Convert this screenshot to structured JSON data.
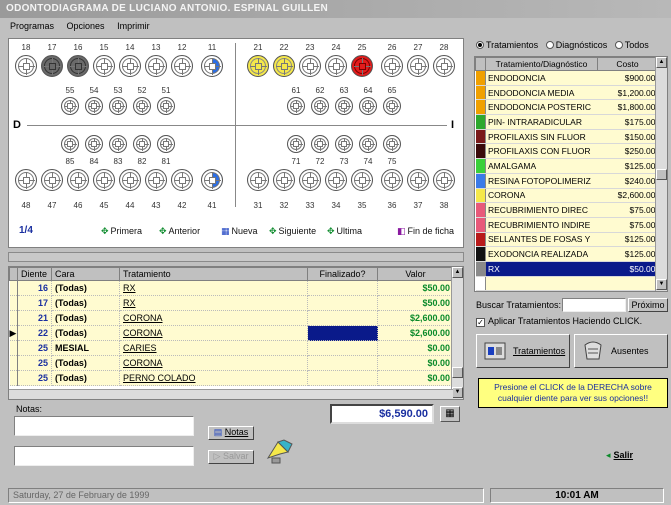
{
  "window": {
    "title": "ODONTODIAGRAMA DE LUCIANO ANTONIO. ESPINAL GUILLEN"
  },
  "menu": [
    "Programas",
    "Opciones",
    "Imprimir"
  ],
  "odontogram": {
    "side_left": "D",
    "side_right": "I",
    "upper_adult": [
      {
        "num": "18",
        "state": "normal"
      },
      {
        "num": "17",
        "state": "gray"
      },
      {
        "num": "16",
        "state": "gray"
      },
      {
        "num": "15",
        "state": "normal"
      },
      {
        "num": "14",
        "state": "normal"
      },
      {
        "num": "13",
        "state": "normal"
      },
      {
        "num": "12",
        "state": "normal"
      },
      {
        "num": "11",
        "state": "bluehalf"
      },
      {
        "num": "21",
        "state": "yellow"
      },
      {
        "num": "22",
        "state": "yellow"
      },
      {
        "num": "23",
        "state": "normal"
      },
      {
        "num": "24",
        "state": "normal"
      },
      {
        "num": "25",
        "state": "red"
      },
      {
        "num": "26",
        "state": "normal"
      },
      {
        "num": "27",
        "state": "normal"
      },
      {
        "num": "28",
        "state": "normal"
      }
    ],
    "upper_child": [
      "55",
      "54",
      "53",
      "52",
      "51",
      "61",
      "62",
      "63",
      "64",
      "65"
    ],
    "lower_child": [
      "85",
      "84",
      "83",
      "82",
      "81",
      "71",
      "72",
      "73",
      "74",
      "75"
    ],
    "lower_adult": [
      {
        "num": "48",
        "state": "normal"
      },
      {
        "num": "47",
        "state": "normal"
      },
      {
        "num": "46",
        "state": "normal"
      },
      {
        "num": "45",
        "state": "normal"
      },
      {
        "num": "44",
        "state": "normal"
      },
      {
        "num": "43",
        "state": "normal"
      },
      {
        "num": "42",
        "state": "normal"
      },
      {
        "num": "41",
        "state": "bluehalf"
      },
      {
        "num": "31",
        "state": "normal"
      },
      {
        "num": "32",
        "state": "normal"
      },
      {
        "num": "33",
        "state": "normal"
      },
      {
        "num": "34",
        "state": "normal"
      },
      {
        "num": "35",
        "state": "normal"
      },
      {
        "num": "36",
        "state": "normal"
      },
      {
        "num": "37",
        "state": "normal"
      },
      {
        "num": "38",
        "state": "normal"
      }
    ]
  },
  "nav": {
    "pager": "1/4",
    "first": "Primera",
    "prev": "Anterior",
    "new": "Nueva",
    "next": "Siguiente",
    "last": "Ultima",
    "end": "Fin de ficha"
  },
  "grid": {
    "headers": [
      "Diente",
      "Cara",
      "Tratamiento",
      "Finalizado?",
      "Valor"
    ],
    "rows": [
      {
        "diente": "16",
        "cara": "(Todas)",
        "trat": "RX",
        "fin": false,
        "valor": "$50.00"
      },
      {
        "diente": "17",
        "cara": "(Todas)",
        "trat": "RX",
        "fin": false,
        "valor": "$50.00"
      },
      {
        "diente": "21",
        "cara": "(Todas)",
        "trat": "CORONA",
        "fin": false,
        "valor": "$2,600.00"
      },
      {
        "diente": "22",
        "cara": "(Todas)",
        "trat": "CORONA",
        "fin": true,
        "valor": "$2,600.00"
      },
      {
        "diente": "25",
        "cara": "MESIAL",
        "trat": "CARIES",
        "fin": false,
        "valor": "$0.00"
      },
      {
        "diente": "25",
        "cara": "(Todas)",
        "trat": "CORONA",
        "fin": false,
        "valor": "$0.00"
      },
      {
        "diente": "25",
        "cara": "(Todas)",
        "trat": "PERNO COLADO",
        "fin": false,
        "valor": "$0.00"
      }
    ],
    "current_row": 3
  },
  "notes": {
    "label": "Notas:",
    "notas_button": "Notas",
    "salvar_button": "Salvar"
  },
  "total": "$6,590.00",
  "filters": {
    "options": [
      "Tratamientos",
      "Diagnósticos",
      "Todos"
    ],
    "selected": 0
  },
  "treatments": {
    "headers": [
      "Tratamiento/Diagnóstico",
      "Costo"
    ],
    "items": [
      {
        "name": "ENDODONCIA",
        "cost": "$900.00",
        "color": "#f0a000"
      },
      {
        "name": "ENDODONCIA MEDIA",
        "cost": "$1,200.00",
        "color": "#f0a000"
      },
      {
        "name": "ENDODONCIA POSTERIC",
        "cost": "$1,800.00",
        "color": "#f0a000"
      },
      {
        "name": "PIN- INTRARADICULAR",
        "cost": "$175.00",
        "color": "#2ea82e"
      },
      {
        "name": "PROFILAXIS SIN FLUOR",
        "cost": "$150.00",
        "color": "#7a1a1a"
      },
      {
        "name": "PROFILAXIS CON FLUOR",
        "cost": "$250.00",
        "color": "#3a0a0a"
      },
      {
        "name": "AMALGAMA",
        "cost": "$125.00",
        "color": "#3ad03a"
      },
      {
        "name": "RESINA FOTOPOLIMERIZ",
        "cost": "$240.00",
        "color": "#3a7ae8"
      },
      {
        "name": "CORONA",
        "cost": "$2,600.00",
        "color": "#f5e84a"
      },
      {
        "name": "RECUBRIMIENTO DIREC",
        "cost": "$75.00",
        "color": "#e85a7a"
      },
      {
        "name": "RECUBRIMIENTO INDIRE",
        "cost": "$75.00",
        "color": "#e85a7a"
      },
      {
        "name": "SELLANTES DE FOSAS Y",
        "cost": "$125.00",
        "color": "#b81a1a"
      },
      {
        "name": "EXODONCIA REALIZADA",
        "cost": "$125.00",
        "color": "#111111"
      },
      {
        "name": "RX",
        "cost": "$50.00",
        "color": "#8a8a8a"
      },
      {
        "name": "",
        "cost": "",
        "color": "#ffffff"
      }
    ],
    "selected": 13
  },
  "search": {
    "label": "Buscar Tratamientos:",
    "value": "",
    "next_button": "Próximo",
    "apply_label": "Aplicar Tratamientos Haciendo CLICK.",
    "apply_checked": true
  },
  "buttons": {
    "treatments": "Tratamientos",
    "absent": "Ausentes",
    "exit": "Salir"
  },
  "hint": "Presione el CLICK de la DERECHA sobre cualquier diente para ver sus opciones!!",
  "status": {
    "date": "Saturday, 27 de February de 1999",
    "time": "10:01 AM"
  }
}
